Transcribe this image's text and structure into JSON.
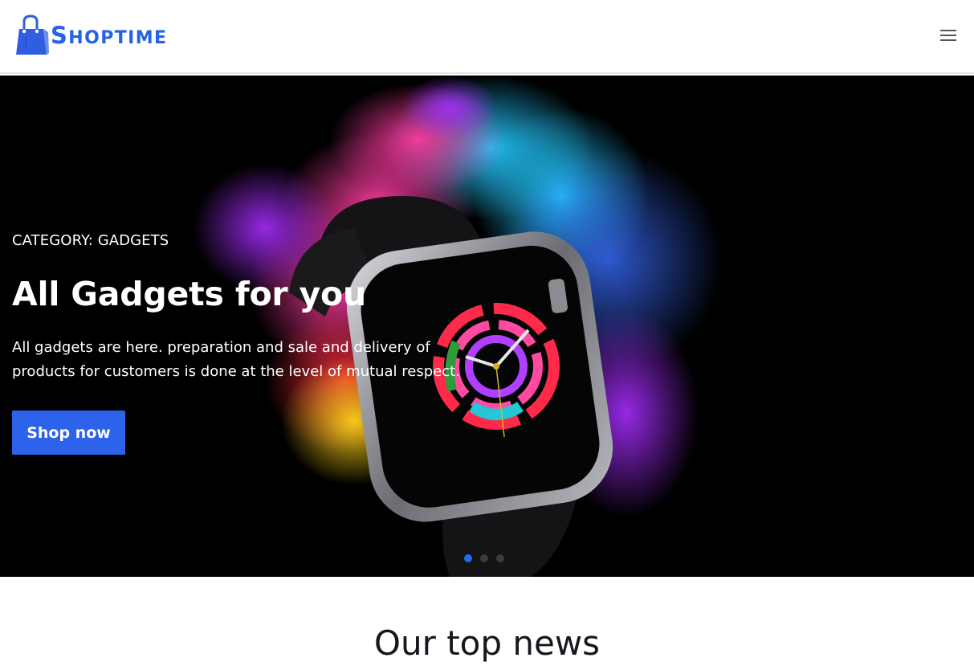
{
  "brand": {
    "name_first": "S",
    "name_rest": "HOPTIME",
    "accent": "#2563e4"
  },
  "nav": {
    "menu_icon": "hamburger-menu-icon"
  },
  "hero": {
    "category": "CATEGORY: GADGETS",
    "title": "All Gadgets for you",
    "description": "All gadgets are here. preparation and sale and delivery of products for customers is done at the level of mutual respect.",
    "cta_label": "Shop now",
    "cta_color": "#2c63ea",
    "image": "smartwatch-with-colorful-smoke",
    "slides": {
      "count": 3,
      "active": 1,
      "active_color": "#1e6ff0"
    }
  },
  "section": {
    "title": "Our top news"
  }
}
